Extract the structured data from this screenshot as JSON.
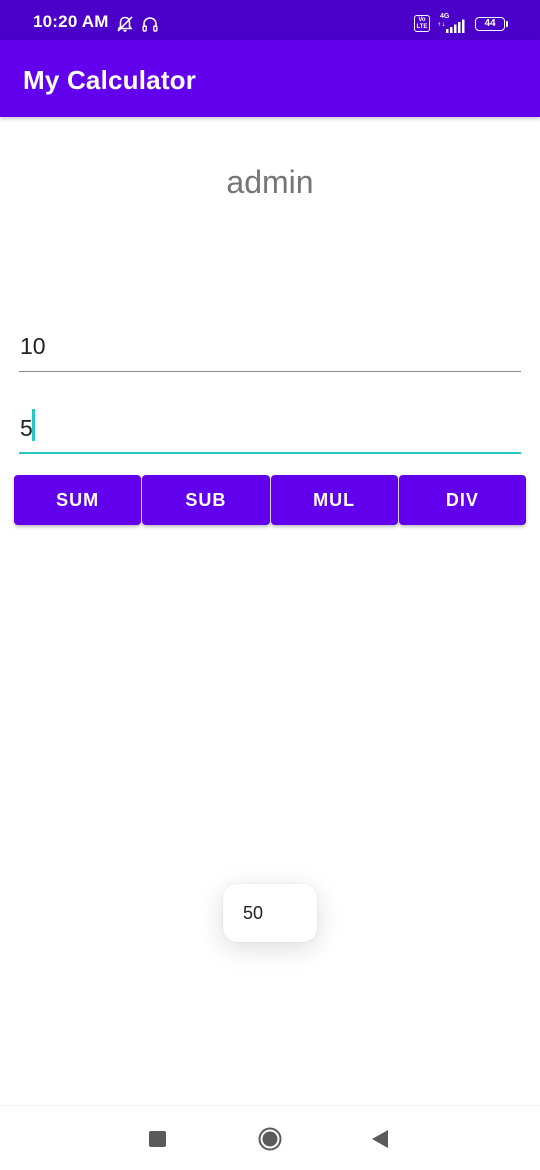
{
  "status_bar": {
    "time": "10:20 AM",
    "volte": "Vo\nLTE",
    "network": "4G",
    "battery": "44",
    "icons": [
      "bell-off-icon",
      "headset-icon",
      "volte-icon",
      "signal-icon",
      "battery-icon"
    ]
  },
  "app_bar": {
    "title": "My Calculator"
  },
  "main": {
    "username": "admin",
    "input1_value": "10",
    "input2_value": "5",
    "buttons": [
      "SUM",
      "SUB",
      "MUL",
      "DIV"
    ]
  },
  "toast": {
    "message": "50"
  },
  "nav_bar": {
    "icons": [
      "recents-square-icon",
      "home-circle-icon",
      "back-triangle-icon"
    ]
  },
  "colors": {
    "status_bar": "#4a00c8",
    "primary": "#6200ee",
    "accent": "#26c6c6",
    "text_secondary": "#757575"
  }
}
